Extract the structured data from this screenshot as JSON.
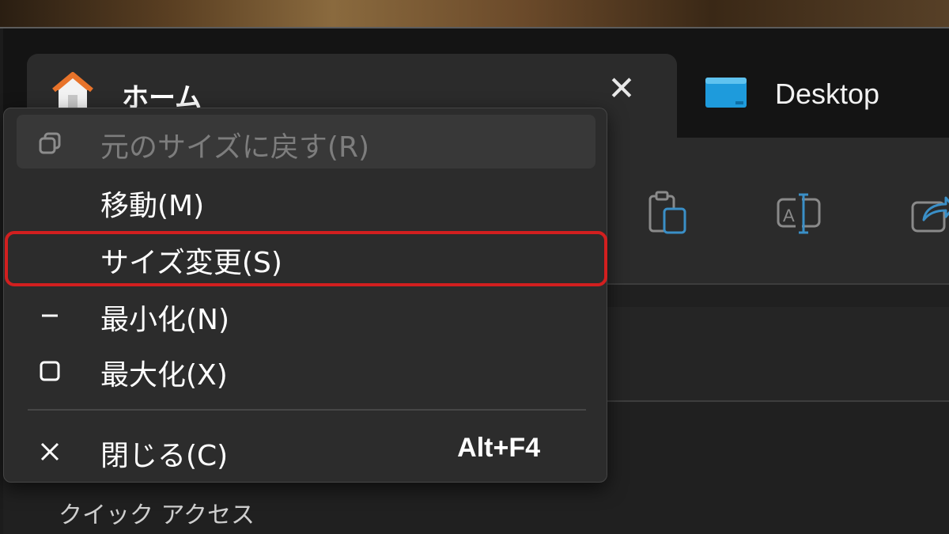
{
  "tabs": [
    {
      "label": "ホーム",
      "close_glyph": "✕",
      "icon": "home-icon"
    },
    {
      "label": "Desktop",
      "icon": "desktop-folder-icon"
    }
  ],
  "system_menu": {
    "items": [
      {
        "label": "元のサイズに戻す(R)",
        "icon": "restore-icon",
        "disabled": true
      },
      {
        "label": "移動(M)",
        "icon": "",
        "disabled": false
      },
      {
        "label": "サイズ変更(S)",
        "icon": "",
        "disabled": false,
        "highlighted": true
      },
      {
        "label": "最小化(N)",
        "icon": "minimize-icon",
        "icon_glyph": "—",
        "disabled": false
      },
      {
        "label": "最大化(X)",
        "icon": "maximize-icon",
        "disabled": false
      },
      {
        "label": "閉じる(C)",
        "icon": "close-icon",
        "icon_glyph": "✕",
        "shortcut": "Alt+F4",
        "disabled": false
      }
    ]
  },
  "toolbar": {
    "icons": [
      "paste-icon",
      "rename-icon",
      "share-icon"
    ]
  },
  "body": {
    "partial_text": "クイック アクセス"
  },
  "colors": {
    "highlight_border": "#d21f1f",
    "menu_background": "#2c2c2c",
    "home_icon_orange": "#e8732a",
    "desktop_icon_blue": "#1e9bdc"
  }
}
